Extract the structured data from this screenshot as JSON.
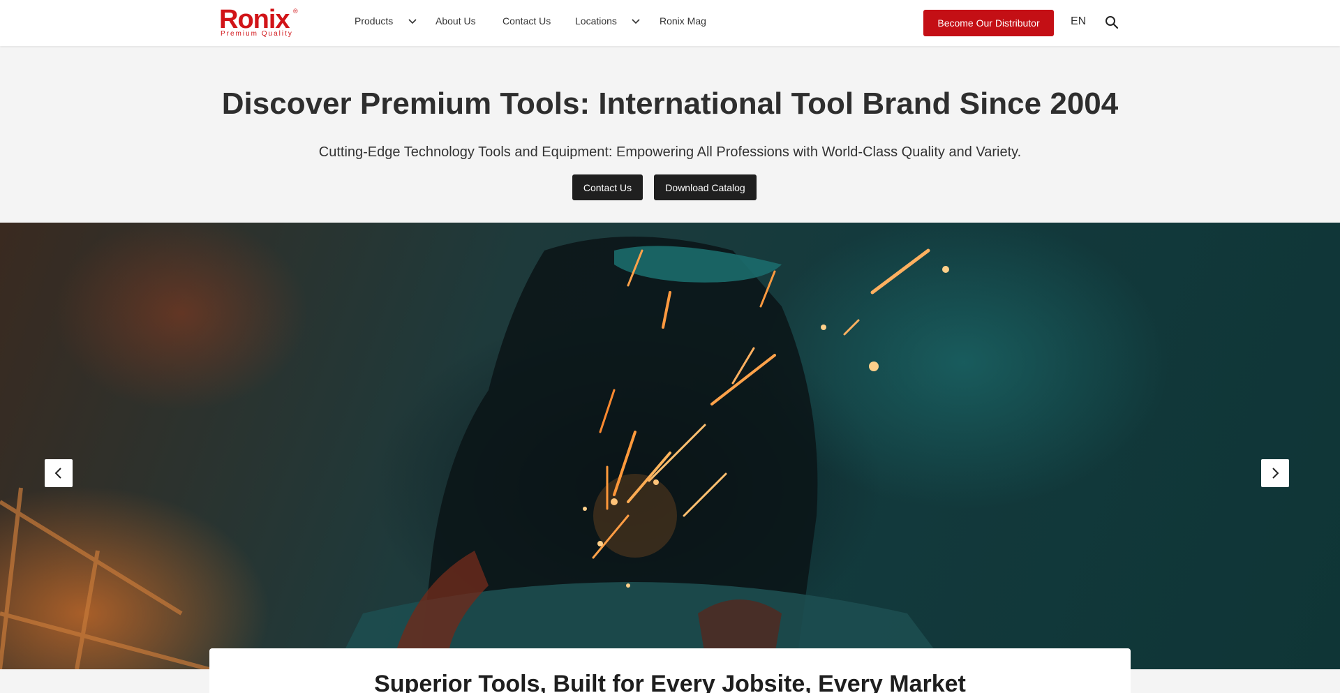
{
  "brand": {
    "name": "Ronix",
    "tagline": "Premium Quality",
    "registered": "®",
    "color": "#d11418"
  },
  "nav": {
    "items": [
      {
        "label": "Products",
        "has_dropdown": true
      },
      {
        "label": "About Us",
        "has_dropdown": false
      },
      {
        "label": "Contact Us",
        "has_dropdown": false
      },
      {
        "label": "Locations",
        "has_dropdown": true
      },
      {
        "label": "Ronix Mag",
        "has_dropdown": false
      }
    ],
    "cta_label": "Become Our Distributor",
    "cta_color": "#c40f15",
    "language": "EN",
    "search_icon": "search-icon",
    "dropdown_icon": "chevron-down-icon"
  },
  "hero": {
    "title": "Discover Premium Tools: International Tool Brand Since 2004",
    "subtitle": "Cutting-Edge Technology Tools and Equipment: Empowering All Professions with World-Class Quality and Variety.",
    "buttons": {
      "contact_label": "Contact Us",
      "catalog_label": "Download Catalog"
    }
  },
  "slider": {
    "image_icon": "welder-grinding-sparks-image",
    "prev_icon": "chevron-left-icon",
    "next_icon": "chevron-right-icon"
  },
  "section": {
    "title": "Superior Tools, Built for Every Jobsite, Every Market"
  }
}
